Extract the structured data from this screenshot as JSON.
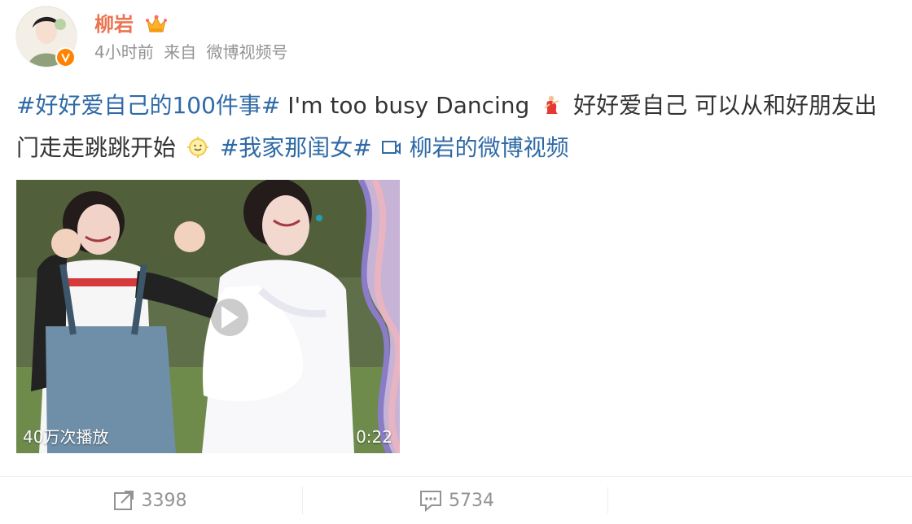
{
  "post": {
    "author": {
      "name": "柳岩",
      "avatar_icon": "avatar",
      "verified_icon": "verified-v-icon",
      "membership_icon": "crown-icon"
    },
    "time": "4小时前",
    "source_prefix": "来自",
    "source": "微博视频号",
    "text_segments": [
      {
        "type": "topic",
        "text": "#好好爱自己的100件事#"
      },
      {
        "type": "plain",
        "text": " I'm too busy Dancing"
      },
      {
        "type": "emoji",
        "name": "dancing-emoji"
      },
      {
        "type": "plain",
        "text": " 好好爱自己 可以从和好朋友出门走走跳跳开始"
      },
      {
        "type": "emoji",
        "name": "sun-face-emoji"
      },
      {
        "type": "plain",
        "text": " "
      },
      {
        "type": "topic",
        "text": "#我家那闺女#"
      },
      {
        "type": "plain",
        "text": " "
      },
      {
        "type": "link_icon",
        "name": "video-link-icon"
      },
      {
        "type": "link",
        "text": "柳岩的微博视频"
      }
    ],
    "video": {
      "views": "40万次播放",
      "duration": "0:22"
    },
    "actions": {
      "repost_count": "3398",
      "comment_count": "5734"
    },
    "colors": {
      "author_name": "#eb7350",
      "topic_link": "#2f6aa6",
      "meta": "#939393",
      "text": "#333333"
    }
  }
}
